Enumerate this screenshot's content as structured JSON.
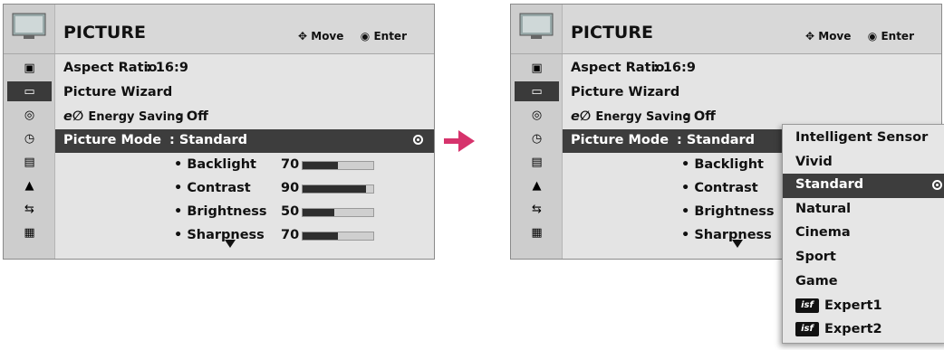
{
  "left_panel": {
    "title": "PICTURE",
    "help": {
      "move": "Move",
      "enter": "Enter"
    },
    "aspect_ratio": {
      "label": "Aspect Ratio",
      "value": ": 16:9"
    },
    "picture_wizard": "Picture Wizard",
    "energy_saving": {
      "label": "Energy Saving",
      "value": ": Off"
    },
    "picture_mode": {
      "label": "Picture Mode",
      "value": ": Standard"
    },
    "sub": [
      {
        "label": "• Backlight",
        "value": "70",
        "level": 0.5
      },
      {
        "label": "• Contrast",
        "value": "90",
        "level": 0.9
      },
      {
        "label": "• Brightness",
        "value": "50",
        "level": 0.45
      },
      {
        "label": "• Sharpness",
        "value": "70",
        "level": 0.5
      }
    ]
  },
  "right_panel": {
    "title": "PICTURE",
    "help": {
      "move": "Move",
      "enter": "Enter"
    },
    "aspect_ratio": {
      "label": "Aspect Ratio",
      "value": ": 16:9"
    },
    "picture_wizard": "Picture Wizard",
    "energy_saving": {
      "label": "Energy Saving",
      "value": ": Off"
    },
    "picture_mode": {
      "label": "Picture Mode",
      "value": ": Standard"
    },
    "sub": [
      {
        "label": "• Backlight"
      },
      {
        "label": "• Contrast"
      },
      {
        "label": "• Brightness"
      },
      {
        "label": "• Sharpness"
      }
    ]
  },
  "popup": {
    "options": [
      "Intelligent Sensor",
      "Vivid",
      "Standard",
      "Natural",
      "Cinema",
      "Sport",
      "Game",
      "Expert1",
      "Expert2"
    ],
    "selected": "Standard",
    "isf_badge": "isf"
  },
  "icons": [
    "picture-icon",
    "audio-icon",
    "time-icon",
    "option-icon",
    "lock-icon",
    "input-icon",
    "usb-icon"
  ],
  "colors": {
    "arrow": "#d6336c",
    "highlight": "#3d3d3d",
    "background": "#e4e4e4"
  }
}
